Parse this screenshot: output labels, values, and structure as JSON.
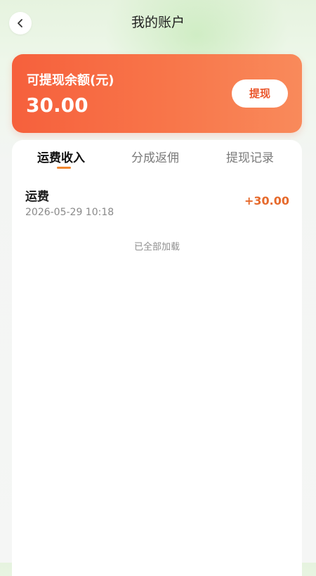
{
  "header": {
    "title": "我的账户",
    "back_icon": "chevron-left-icon"
  },
  "balance": {
    "label": "可提现余额(元)",
    "amount": "30.00",
    "withdraw_label": "提现"
  },
  "tabs": [
    {
      "label": "运费收入",
      "active": true
    },
    {
      "label": "分成返佣",
      "active": false
    },
    {
      "label": "提现记录",
      "active": false
    }
  ],
  "records": [
    {
      "title": "运费",
      "time": "2026-05-29 10:18",
      "amount": "+30.00"
    }
  ],
  "list_footer": "已全部加载",
  "colors": {
    "card_start": "#f6603c",
    "card_end": "#f98a5b",
    "amount": "#e66a2c",
    "tab_indicator": "#f0862f",
    "withdraw_text": "#ea5429"
  }
}
